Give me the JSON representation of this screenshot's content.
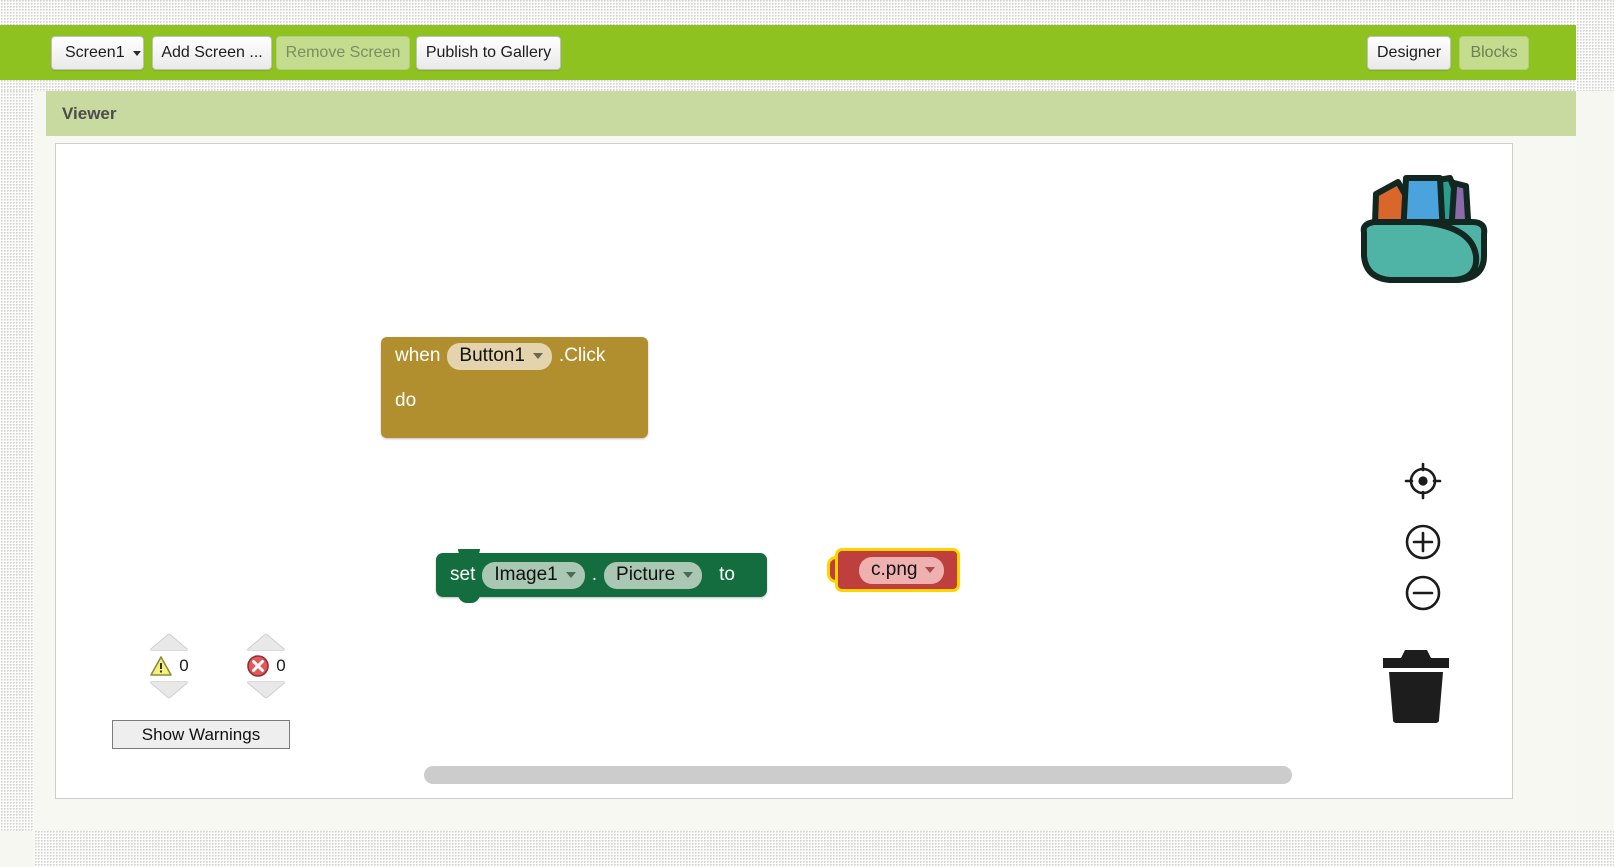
{
  "toolbar": {
    "screen_selector": {
      "label": "Screen1",
      "icon": "chevron-down-icon"
    },
    "add_screen": "Add Screen ...",
    "remove_screen": "Remove Screen",
    "publish_gallery": "Publish to Gallery",
    "designer_tab": "Designer",
    "blocks_tab": "Blocks",
    "background_color": "#8ec220"
  },
  "viewer": {
    "title": "Viewer"
  },
  "blocks": {
    "event_block": {
      "keyword_when": "when",
      "component": "Button1",
      "event": ".Click",
      "keyword_do": "do",
      "color": "#b18e2e"
    },
    "set_block": {
      "keyword_set": "set",
      "component": "Image1",
      "separator": ".",
      "property": "Picture",
      "keyword_to": "to",
      "color": "#136d3e"
    },
    "value_block": {
      "value": "c.png",
      "color": "#bf3e3e",
      "selected": true,
      "selection_color": "#ffd400"
    }
  },
  "indicators": {
    "warning_count": "0",
    "error_count": "0",
    "show_warnings_label": "Show Warnings",
    "warning_icon": "warning-triangle-icon",
    "error_icon": "error-circle-icon"
  },
  "workspace_controls": {
    "center_label": "center-blocks-icon",
    "zoom_in_label": "zoom-in-icon",
    "zoom_out_label": "zoom-out-icon",
    "trash_label": "trash-icon",
    "backpack_label": "backpack-icon"
  }
}
